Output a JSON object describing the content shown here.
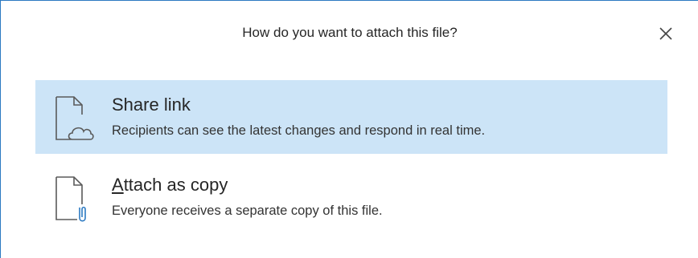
{
  "dialog": {
    "title": "How do you want to attach this file?",
    "close_icon": "close-icon",
    "accent_color": "#2b79c2",
    "selected_color": "#cce4f7"
  },
  "options": [
    {
      "label": "Share link",
      "description": "Recipients can see the latest changes and respond in real time.",
      "icon": "cloud-document-icon",
      "selected": true
    },
    {
      "label_access_key": "A",
      "label_rest": "ttach as copy",
      "description": "Everyone receives a separate copy of this file.",
      "icon": "paperclip-document-icon",
      "selected": false
    }
  ]
}
